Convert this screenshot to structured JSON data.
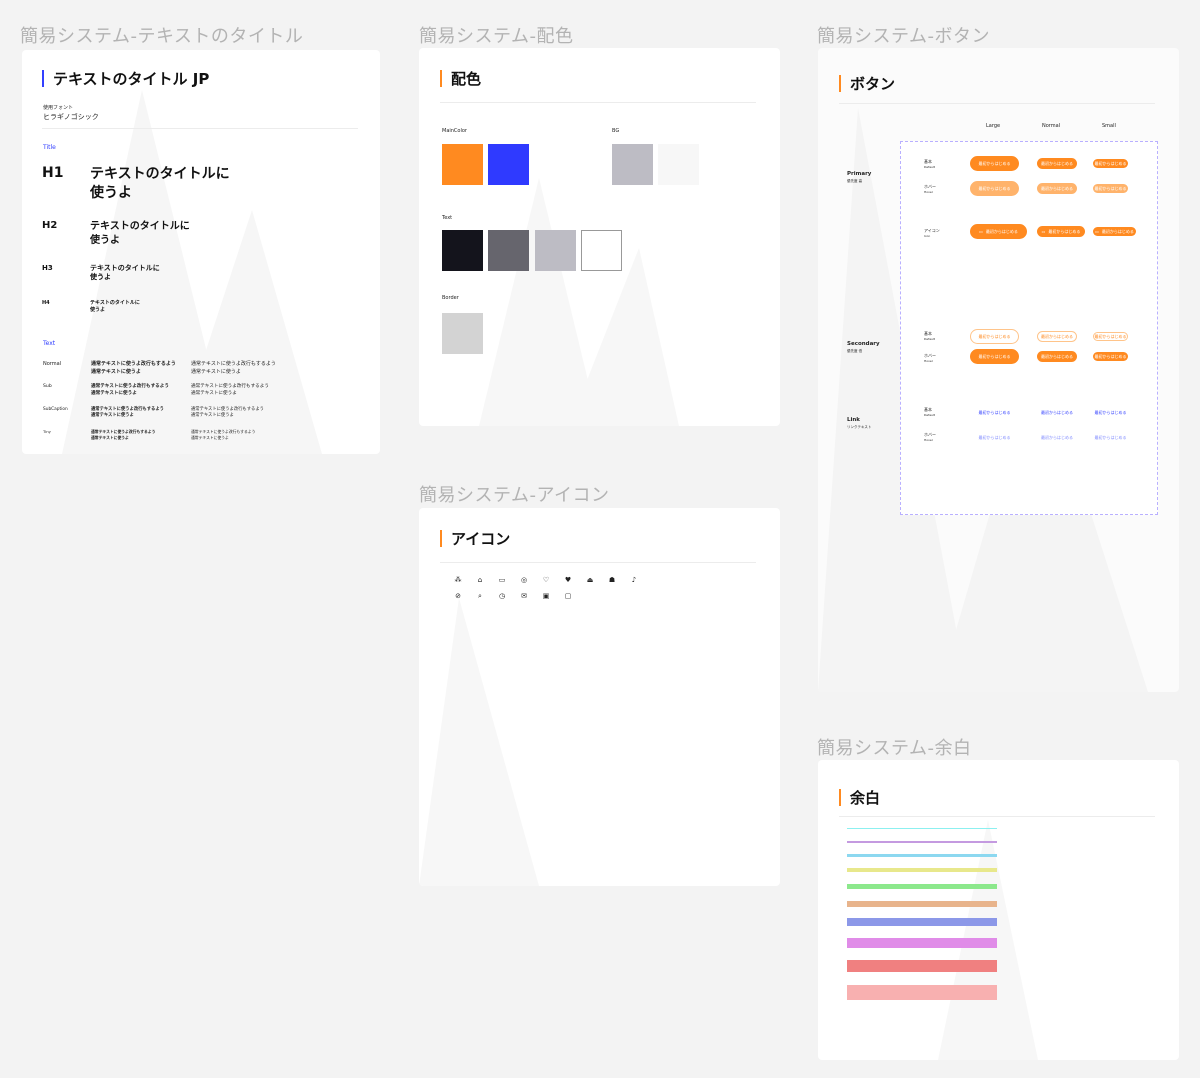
{
  "frames": {
    "text": "簡易システム-テキストのタイトル",
    "color": "簡易システム-配色",
    "button": "簡易システム-ボタン",
    "icon": "簡易システム-アイコン",
    "spacing": "簡易システム-余白"
  },
  "text_panel": {
    "title": "テキストのタイトル JP",
    "font_caption": "使用フォント",
    "font_name": "ヒラギノゴシック",
    "title_section": "Title",
    "headings": [
      {
        "tag": "H1",
        "line1": "テキストのタイトルに",
        "line2": "使うよ"
      },
      {
        "tag": "H2",
        "line1": "テキストのタイトルに",
        "line2": "使うよ"
      },
      {
        "tag": "H3",
        "line1": "テキストのタイトルに",
        "line2": "使うよ"
      },
      {
        "tag": "H4",
        "line1": "テキストのタイトルに",
        "line2": "使うよ"
      }
    ],
    "text_section": "Text",
    "text_rows": [
      {
        "name": "Normal",
        "bold1": "通常テキストに使うよ改行もするよう",
        "bold2": "通常テキストに使うよ",
        "reg1": "通常テキストに使うよ改行もするよう",
        "reg2": "通常テキストに使うよ"
      },
      {
        "name": "Sub",
        "bold1": "通常テキストに使うよ改行もするよう",
        "bold2": "通常テキストに使うよ",
        "reg1": "通常テキストに使うよ改行もするよう",
        "reg2": "通常テキストに使うよ"
      },
      {
        "name": "SubCaption",
        "bold1": "通常テキストに使うよ改行もするよう",
        "bold2": "通常テキストに使うよ",
        "reg1": "通常テキストに使うよ改行もするよう",
        "reg2": "通常テキストに使うよ"
      },
      {
        "name": "Tiny",
        "bold1": "通常テキストに使うよ改行もするよう",
        "bold2": "通常テキストに使うよ",
        "reg1": "通常テキストに使うよ改行もするよう",
        "reg2": "通常テキストに使うよ"
      }
    ]
  },
  "color_panel": {
    "title": "配色",
    "main_label": "MainColor",
    "bg_label": "BG",
    "text_label": "Text",
    "border_label": "Border",
    "main_colors": [
      "#ff8a20",
      "#2f3aff"
    ],
    "bg_colors": [
      "#bdbcc4",
      "#f7f7f7"
    ],
    "text_colors": [
      "#14141c",
      "#66656d",
      "#bdbcc4",
      "#ffffff"
    ],
    "border_colors": [
      "#d3d3d3"
    ]
  },
  "icon_panel": {
    "title": "アイコン",
    "row1": [
      "⁂",
      "⌂",
      "▭",
      "◎",
      "♡",
      "♥",
      "⏏",
      "☗",
      "♪"
    ],
    "row2": [
      "⊘",
      "⌕",
      "◷",
      "✉",
      "▣",
      "▢"
    ],
    "row1_names": [
      "apps-icon",
      "home-icon",
      "video-icon",
      "target-icon",
      "heart-outline-icon",
      "heart-filled-icon",
      "eject-icon",
      "house-filled-icon",
      "bell-icon"
    ],
    "row2_names": [
      "block-icon",
      "search-icon",
      "clock-icon",
      "mail-icon",
      "image-icon",
      "folder-icon"
    ]
  },
  "button_panel": {
    "title": "ボタン",
    "size_large": "Large",
    "size_normal": "Normal",
    "size_small": "Small",
    "primary": "Primary",
    "primary_sub": "優先度 高",
    "secondary": "Secondary",
    "secondary_sub": "優先度 低",
    "link": "Link",
    "link_sub": "リンクテキスト",
    "state_default": "基本",
    "state_default_en": "Default",
    "state_hover": "ホバー",
    "state_hover_en": "Hover",
    "state_icon": "アイコン",
    "state_icon_en": "Icon",
    "button_text": "最初からはじめる",
    "colors": {
      "primary": "#ff8a20",
      "primary_hover": "#ffb36b",
      "link": "#3340ff"
    }
  },
  "spacing_panel": {
    "title": "余白",
    "stripes": [
      "#8cf0f0",
      "#c49ae0",
      "#8cd8f0",
      "#e8e88c",
      "#8ce88c",
      "#e8b48c",
      "#8c98e8",
      "#e08ce8",
      "#f08080",
      "#f8b0b0"
    ]
  }
}
